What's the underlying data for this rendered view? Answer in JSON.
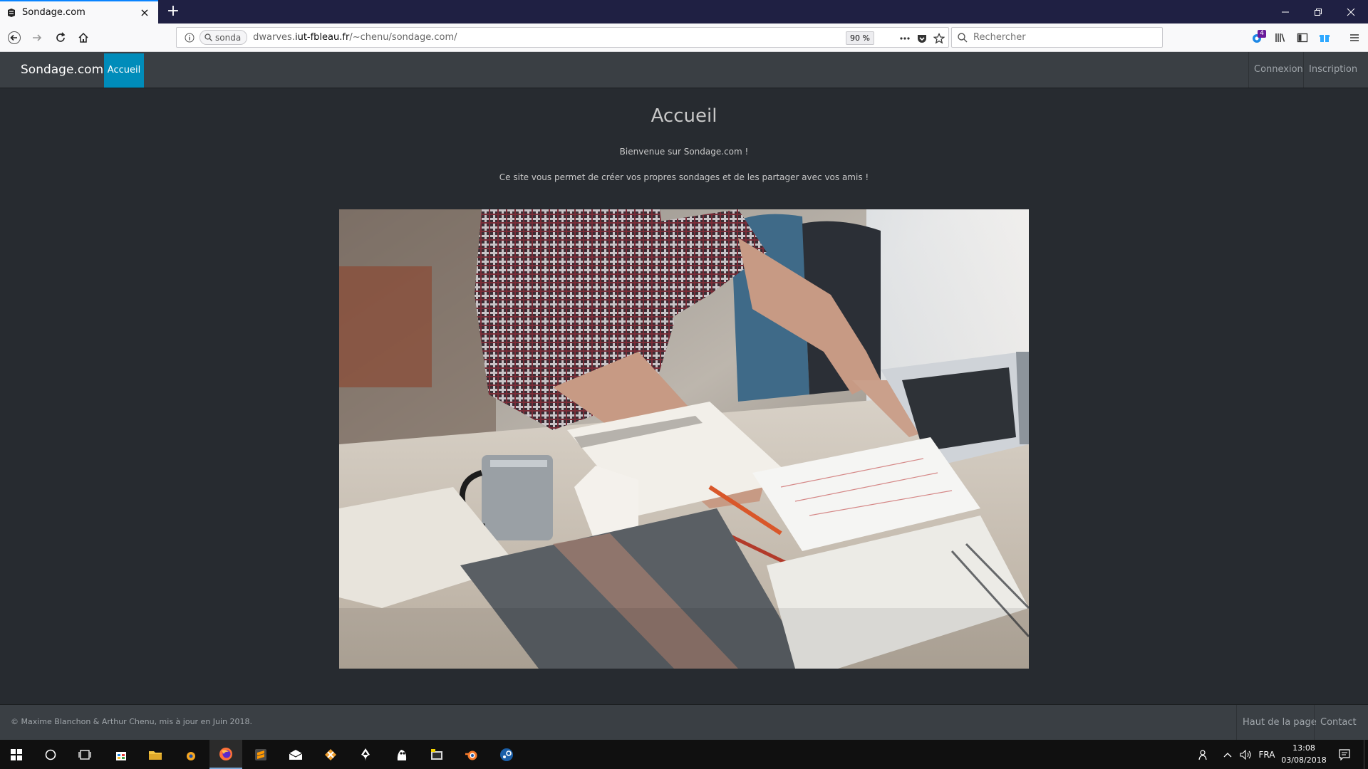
{
  "browser": {
    "tab_title": "Sondage.com",
    "new_tab": "+",
    "url_chip": "sonda",
    "url_prefix": "dwarves.",
    "url_domain": "iut-fbleau.fr",
    "url_path": "/~chenu/sondage.com/",
    "zoom": "90 %",
    "search_placeholder": "Rechercher",
    "badge_count": "4"
  },
  "site": {
    "brand": "Sondage.com",
    "nav_active": "Accueil",
    "nav_right": [
      "Connexion",
      "Inscription"
    ],
    "title": "Accueil",
    "welcome": "Bienvenue sur Sondage.com !",
    "description": "Ce site vous permet de créer vos propres sondages et de les partager avec vos amis !",
    "footer_copy": "© Maxime Blanchon & Arthur Chenu, mis à jour en Juin 2018.",
    "footer_links": [
      "Haut de la page",
      "Contact"
    ]
  },
  "taskbar": {
    "lang": "FRA",
    "time": "13:08",
    "date": "03/08/2018"
  },
  "colors": {
    "page_bg": "#272b30",
    "navbar_bg": "#3a3f44",
    "accent": "#008cba",
    "tabbar_bg": "#1f2043"
  }
}
